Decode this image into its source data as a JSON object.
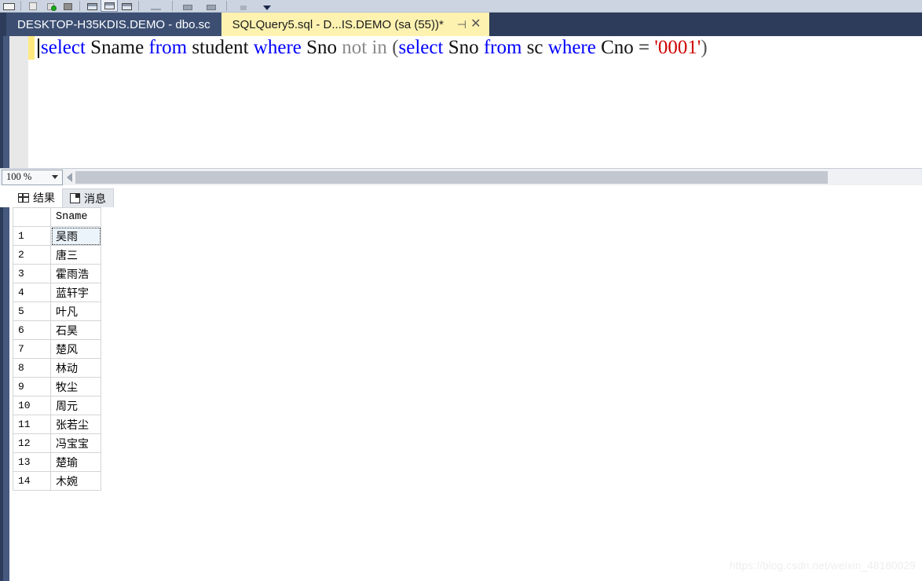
{
  "toolbar": {
    "icons": [
      "window-icon",
      "new-query-icon",
      "execute-icon",
      "save-icon",
      "results-to-grid-icon",
      "results-to-text-icon",
      "results-to-file-icon",
      "separator-icon",
      "indent-icon",
      "comment-icon",
      "uncomment-icon",
      "overflow-caret-icon"
    ]
  },
  "tabs": {
    "inactive": {
      "label": "DESKTOP-H35KDIS.DEMO - dbo.sc"
    },
    "active": {
      "label": "SQLQuery5.sql - D...IS.DEMO (sa (55))*",
      "pin_icon": "pin-icon",
      "close_icon": "close-icon"
    }
  },
  "editor": {
    "query_plain": "select Sname from student where Sno not in (select Sno from sc where Cno = '0001')",
    "tokens": [
      {
        "text": "select",
        "kind": "kw"
      },
      {
        "text": " ",
        "kind": "plain"
      },
      {
        "text": "Sname",
        "kind": "plain"
      },
      {
        "text": " ",
        "kind": "plain"
      },
      {
        "text": "from",
        "kind": "kw"
      },
      {
        "text": " ",
        "kind": "plain"
      },
      {
        "text": "student",
        "kind": "plain"
      },
      {
        "text": " ",
        "kind": "plain"
      },
      {
        "text": "where",
        "kind": "kw"
      },
      {
        "text": " ",
        "kind": "plain"
      },
      {
        "text": "Sno",
        "kind": "plain"
      },
      {
        "text": " ",
        "kind": "plain"
      },
      {
        "text": "not",
        "kind": "gray"
      },
      {
        "text": " ",
        "kind": "plain"
      },
      {
        "text": "in",
        "kind": "gray"
      },
      {
        "text": " ",
        "kind": "plain"
      },
      {
        "text": "(",
        "kind": "punct"
      },
      {
        "text": "select",
        "kind": "kw"
      },
      {
        "text": " ",
        "kind": "plain"
      },
      {
        "text": "Sno",
        "kind": "plain"
      },
      {
        "text": " ",
        "kind": "plain"
      },
      {
        "text": "from",
        "kind": "kw"
      },
      {
        "text": " ",
        "kind": "plain"
      },
      {
        "text": "sc",
        "kind": "plain"
      },
      {
        "text": " ",
        "kind": "plain"
      },
      {
        "text": "where",
        "kind": "kw"
      },
      {
        "text": " ",
        "kind": "plain"
      },
      {
        "text": "Cno",
        "kind": "plain"
      },
      {
        "text": " ",
        "kind": "plain"
      },
      {
        "text": "=",
        "kind": "plain"
      },
      {
        "text": " ",
        "kind": "plain"
      },
      {
        "text": "'0001'",
        "kind": "str"
      },
      {
        "text": ")",
        "kind": "punct"
      }
    ]
  },
  "statusbar": {
    "zoom_value": "100 %",
    "zoom_caret_icon": "chevron-down-icon",
    "hscroll_left_arrow_icon": "scroll-left-arrow-icon"
  },
  "result_tabs": [
    {
      "label": "结果",
      "icon": "grid-icon",
      "active": true
    },
    {
      "label": "消息",
      "icon": "message-icon",
      "active": false
    }
  ],
  "grid": {
    "columns": [
      "",
      "Sname"
    ],
    "rows": [
      {
        "num": "1",
        "sname": "吴雨",
        "selected": true
      },
      {
        "num": "2",
        "sname": "唐三",
        "selected": false
      },
      {
        "num": "3",
        "sname": "霍雨浩",
        "selected": false
      },
      {
        "num": "4",
        "sname": "蓝轩宇",
        "selected": false
      },
      {
        "num": "5",
        "sname": "叶凡",
        "selected": false
      },
      {
        "num": "6",
        "sname": "石昊",
        "selected": false
      },
      {
        "num": "7",
        "sname": "楚风",
        "selected": false
      },
      {
        "num": "8",
        "sname": "林动",
        "selected": false
      },
      {
        "num": "9",
        "sname": "牧尘",
        "selected": false
      },
      {
        "num": "10",
        "sname": "周元",
        "selected": false
      },
      {
        "num": "11",
        "sname": "张若尘",
        "selected": false
      },
      {
        "num": "12",
        "sname": "冯宝宝",
        "selected": false
      },
      {
        "num": "13",
        "sname": "楚瑜",
        "selected": false
      },
      {
        "num": "14",
        "sname": "木婉",
        "selected": false
      }
    ]
  },
  "watermark": {
    "text": "https://blog.csdn.net/weixin_48180029"
  },
  "colors": {
    "chrome_navy": "#2d3c5a",
    "tab_active_bg": "#fdf2b0",
    "tab_inactive_bg": "#3c4f73",
    "keyword_blue": "#0000ff",
    "string_red": "#d00000",
    "change_bar_yellow": "#ffe97f"
  }
}
